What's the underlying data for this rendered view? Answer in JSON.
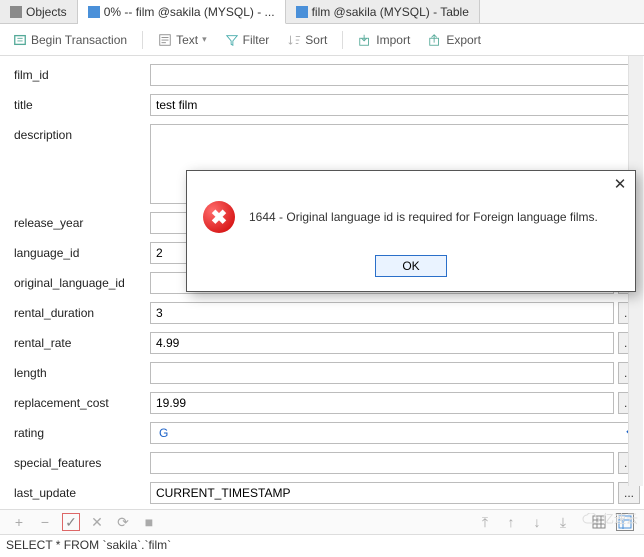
{
  "tabs": {
    "objects": "Objects",
    "t1": "0% -- film @sakila (MYSQL) - ...",
    "t2": "film @sakila (MYSQL) - Table"
  },
  "toolbar": {
    "begin": "Begin Transaction",
    "text": "Text",
    "filter": "Filter",
    "sort": "Sort",
    "import": "Import",
    "export": "Export"
  },
  "fields": {
    "film_id": {
      "label": "film_id",
      "value": ""
    },
    "title": {
      "label": "title",
      "value": "test film"
    },
    "description": {
      "label": "description",
      "value": ""
    },
    "release_year": {
      "label": "release_year",
      "value": ""
    },
    "language_id": {
      "label": "language_id",
      "value": "2"
    },
    "original_language_id": {
      "label": "original_language_id",
      "value": ""
    },
    "rental_duration": {
      "label": "rental_duration",
      "value": "3"
    },
    "rental_rate": {
      "label": "rental_rate",
      "value": "4.99"
    },
    "length": {
      "label": "length",
      "value": ""
    },
    "replacement_cost": {
      "label": "replacement_cost",
      "value": "19.99"
    },
    "rating": {
      "label": "rating",
      "value": "G"
    },
    "special_features": {
      "label": "special_features",
      "value": ""
    },
    "last_update": {
      "label": "last_update",
      "value": "CURRENT_TIMESTAMP"
    }
  },
  "dots": "...",
  "dialog": {
    "message": "1644 - Original language id is required for Foreign language films.",
    "ok": "OK",
    "close": "✕"
  },
  "status": "SELECT * FROM `sakila`.`film`",
  "watermark": "亿速云"
}
